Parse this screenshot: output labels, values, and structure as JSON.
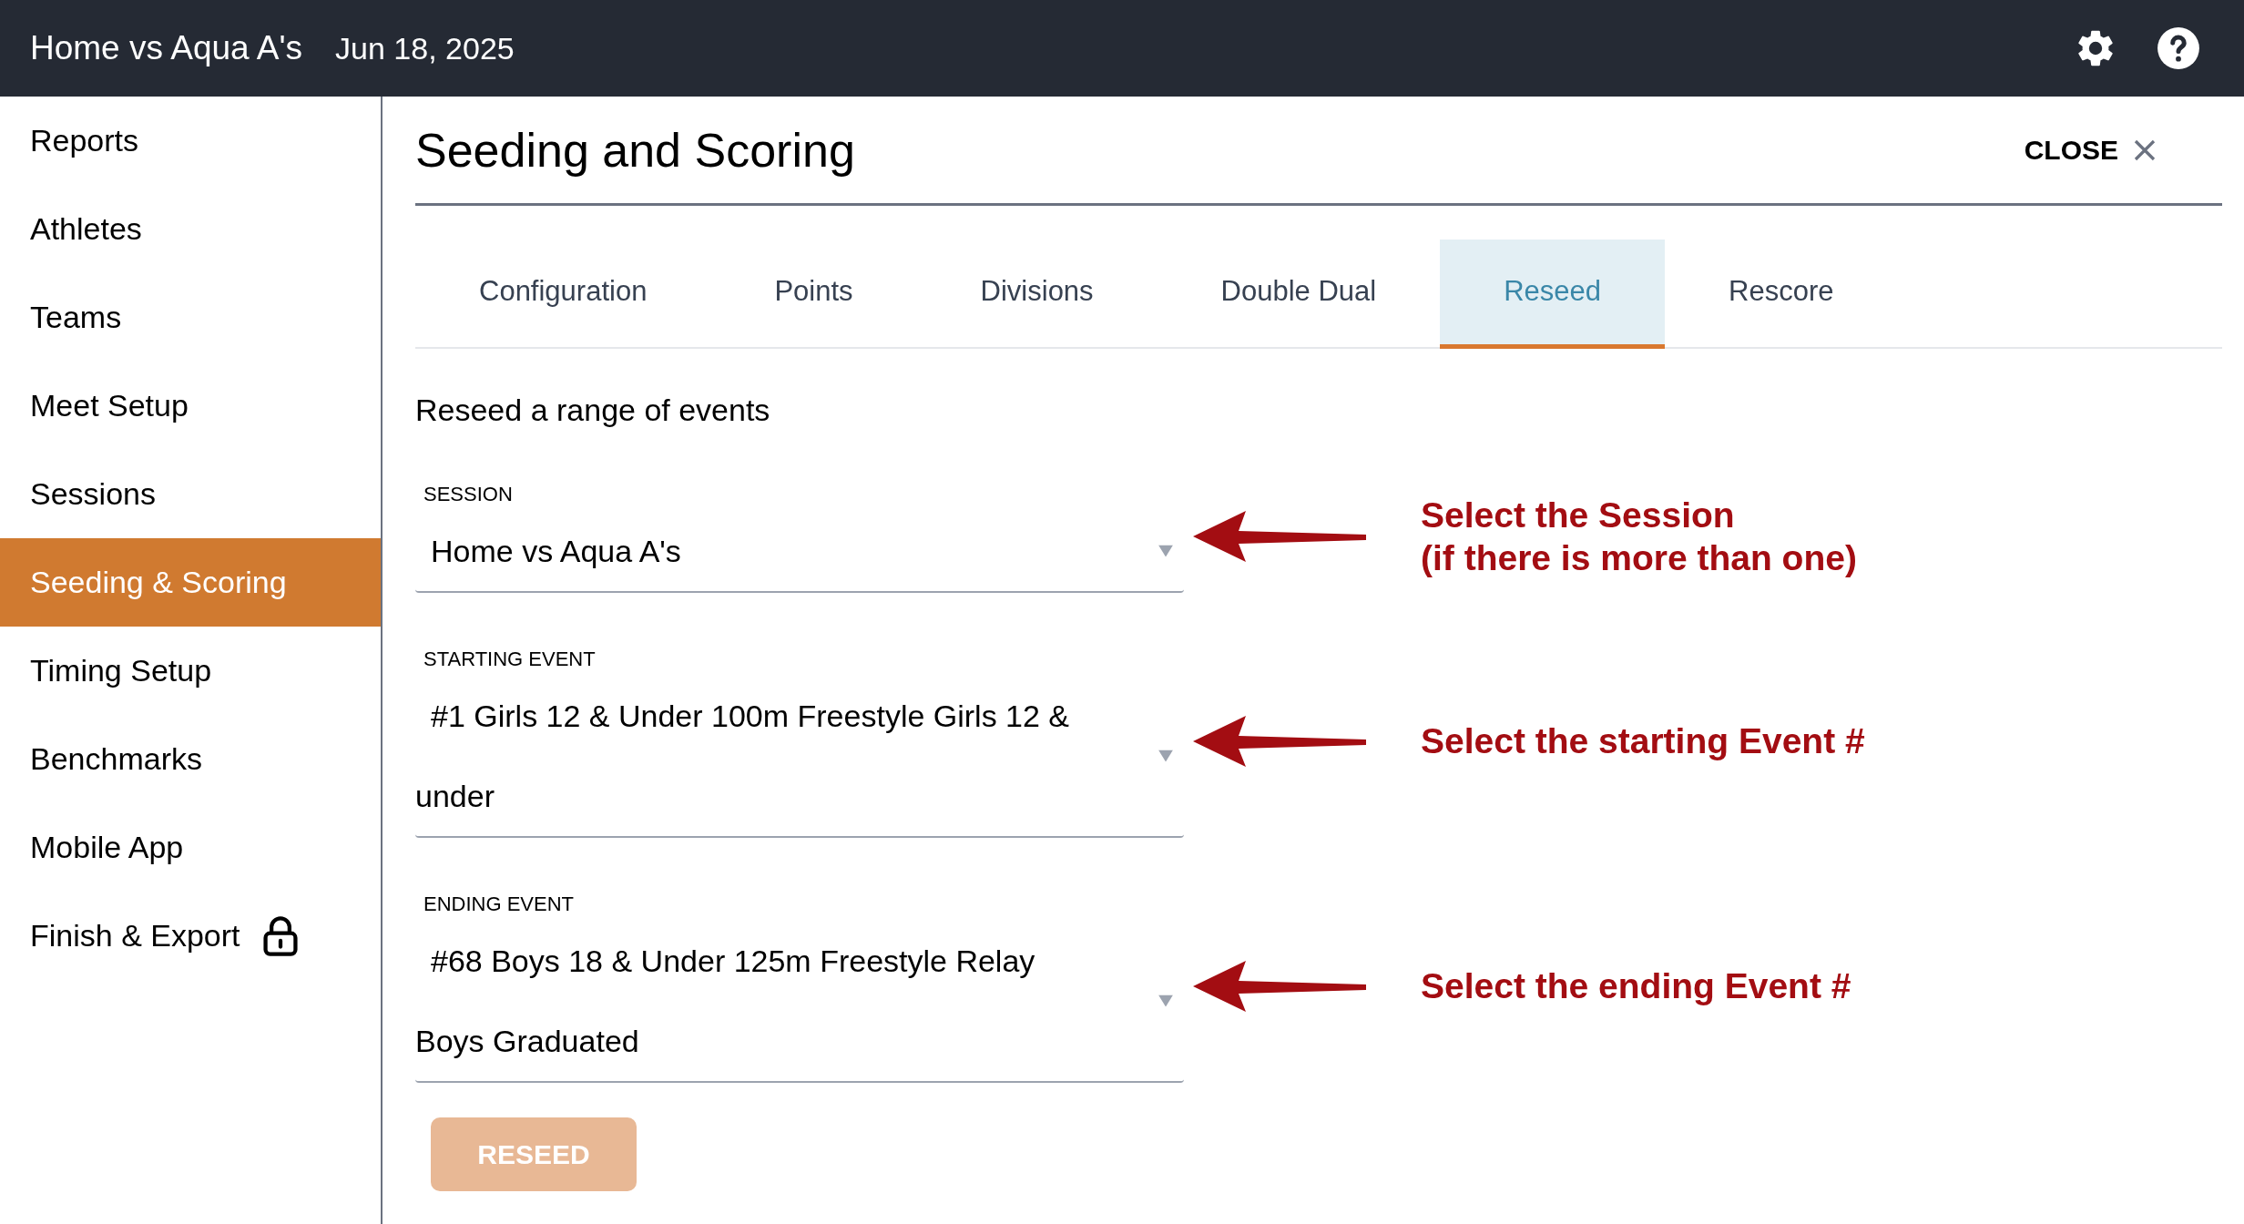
{
  "header": {
    "title": "Home vs Aqua A's",
    "date": "Jun 18, 2025"
  },
  "sidebar": {
    "items": [
      {
        "label": "Reports",
        "selected": false,
        "locked": false
      },
      {
        "label": "Athletes",
        "selected": false,
        "locked": false
      },
      {
        "label": "Teams",
        "selected": false,
        "locked": false
      },
      {
        "label": "Meet Setup",
        "selected": false,
        "locked": false
      },
      {
        "label": "Sessions",
        "selected": false,
        "locked": false
      },
      {
        "label": "Seeding & Scoring",
        "selected": true,
        "locked": false
      },
      {
        "label": "Timing Setup",
        "selected": false,
        "locked": false
      },
      {
        "label": "Benchmarks",
        "selected": false,
        "locked": false
      },
      {
        "label": "Mobile App",
        "selected": false,
        "locked": false
      },
      {
        "label": "Finish & Export",
        "selected": false,
        "locked": true
      }
    ]
  },
  "panel": {
    "title": "Seeding and Scoring",
    "close": "CLOSE"
  },
  "tabs": [
    {
      "label": "Configuration",
      "selected": false
    },
    {
      "label": "Points",
      "selected": false
    },
    {
      "label": "Divisions",
      "selected": false
    },
    {
      "label": "Double Dual",
      "selected": false
    },
    {
      "label": "Reseed",
      "selected": true
    },
    {
      "label": "Rescore",
      "selected": false
    }
  ],
  "heading": "Reseed a range of events",
  "fields": [
    {
      "label": "SESSION",
      "value": "Home vs Aqua A's",
      "annotation": [
        "Select the Session",
        "(if there is more than one)"
      ]
    },
    {
      "label": "STARTING EVENT",
      "value": "#1 Girls 12 & Under 100m Freestyle Girls 12 & under",
      "annotation": [
        "Select the starting Event #"
      ]
    },
    {
      "label": "ENDING EVENT",
      "value": "#68 Boys 18 & Under 125m Freestyle Relay Boys Graduated",
      "annotation": [
        "Select the ending Event #"
      ]
    }
  ],
  "button": {
    "label": "RESEED",
    "disabled": true
  }
}
